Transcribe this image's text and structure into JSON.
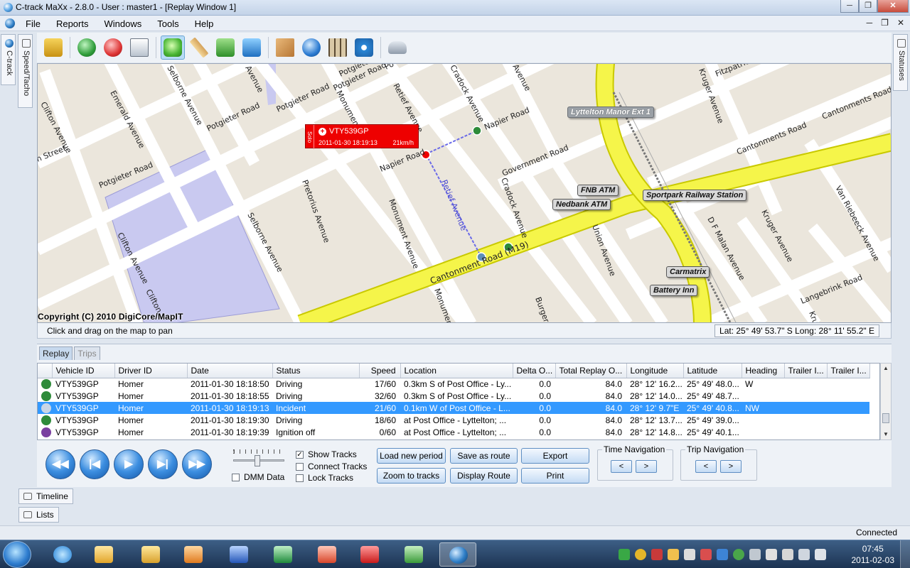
{
  "window": {
    "title": "C-track MaXx - 2.8.0 - User : master1 - [Replay Window 1]",
    "min": "─",
    "max": "❐",
    "close": "✕"
  },
  "menu": {
    "items": [
      "File",
      "Reports",
      "Windows",
      "Tools",
      "Help"
    ],
    "mdi": [
      "─",
      "❐",
      "✕"
    ]
  },
  "side_tabs": {
    "left": [
      "C-track",
      "Speed/Tacho"
    ],
    "right": [
      "Statuses"
    ]
  },
  "toolbar": {
    "buttons": [
      "vehicle-locate",
      "zoom-in",
      "zoom-out",
      "window-select",
      "pan",
      "measure",
      "refresh",
      "download",
      "map-layers",
      "info",
      "grid",
      "settings",
      "vehicle"
    ]
  },
  "map": {
    "copyright": "Copyright (C) 2010 DigiCore/MapIT",
    "streets": [
      "Clifton Avenue",
      "Emerald Avenue",
      "Selborne Avenue",
      "Potgieter Road",
      "Potgieter Road",
      "Potgieter Road",
      "Potgieter Road",
      "Po",
      "Avenue",
      "Monument",
      "Retief Avenue",
      "Cradock Avenue",
      "Avenue",
      "Napier Road",
      "Napier Road",
      "Government Road",
      "Fitzpatrick",
      "Kruger Avenue",
      "Cantonments Road",
      "Cantonments Road",
      "h Street",
      "Potgieter Road",
      "Pretorius Avenue",
      "Selborne Avenue",
      "Monument Avenue",
      "Cradock Avenue",
      "Union Avenue",
      "D F Malan Avenue",
      "Kruger Avenue",
      "Van Riebeeck Avenue",
      "Clifton Avenue",
      "Clifton",
      "Cantonment Road (M19)",
      "Monument",
      "Burger",
      "Langebrink Road",
      "Kru",
      "Retief Avenue"
    ],
    "pois": [
      "Lyttelton Manor Ext 1",
      "FNB ATM",
      "Nedbank ATM",
      "Sportpark Railway Station",
      "Carmatrix",
      "Battery Inn"
    ],
    "callout": {
      "side": "Solo",
      "vehicle": "VTY539GP",
      "datetime": "2011-01-30 18:19:13",
      "speed": "21km/h"
    },
    "hint": "Click and drag on the map to pan",
    "coords": "Lat: 25° 49' 53.7\" S  Long: 28° 11' 55.2\" E"
  },
  "panel": {
    "tabs": [
      "Replay",
      "Trips"
    ],
    "columns": [
      "Vehicle ID",
      "Driver ID",
      "Date",
      "Status",
      "Speed",
      "Location",
      "Delta O...",
      "Total Replay O...",
      "Longitude",
      "Latitude",
      "Heading",
      "Trailer I...",
      "Trailer I..."
    ],
    "rows": [
      {
        "vehicle": "VTY539GP",
        "driver": "Homer",
        "date": "2011-01-30 18:18:50",
        "status": "Driving",
        "speed": "17/60",
        "location": "0.3km S of Post Office - Ly...",
        "delta": "0.0",
        "total": "84.0",
        "lon": "28° 12' 16.2...",
        "lat": "25° 49' 48.0...",
        "heading": "W",
        "icon": "#2e8b3a"
      },
      {
        "vehicle": "VTY539GP",
        "driver": "Homer",
        "date": "2011-01-30 18:18:55",
        "status": "Driving",
        "speed": "32/60",
        "location": "0.3km S of Post Office - Ly...",
        "delta": "0.0",
        "total": "84.0",
        "lon": "28° 12' 14.0...",
        "lat": "25° 49' 48.7...",
        "heading": "",
        "icon": "#2e8b3a"
      },
      {
        "vehicle": "VTY539GP",
        "driver": "Homer",
        "date": "2011-01-30 18:19:13",
        "status": "Incident",
        "speed": "21/60",
        "location": "0.1km W of Post Office - L...",
        "delta": "0.0",
        "total": "84.0",
        "lon": "28° 12' 9.7\"E",
        "lat": "25° 49' 40.8...",
        "heading": "NW",
        "icon": "#c9d6e6",
        "selected": true
      },
      {
        "vehicle": "VTY539GP",
        "driver": "Homer",
        "date": "2011-01-30 18:19:30",
        "status": "Driving",
        "speed": "18/60",
        "location": "at Post Office - Lyttelton; ...",
        "delta": "0.0",
        "total": "84.0",
        "lon": "28° 12' 13.7...",
        "lat": "25° 49' 39.0...",
        "heading": "",
        "icon": "#2e8b3a"
      },
      {
        "vehicle": "VTY539GP",
        "driver": "Homer",
        "date": "2011-01-30 18:19:39",
        "status": "Ignition off",
        "speed": "0/60",
        "location": "at Post Office - Lyttelton; ...",
        "delta": "0.0",
        "total": "84.0",
        "lon": "28° 12' 14.8...",
        "lat": "25° 49' 40.1...",
        "heading": "",
        "icon": "#7a3fa0"
      }
    ],
    "nav": [
      "◀◀",
      "|◀",
      "▶",
      "▶|",
      "▶▶"
    ],
    "checks": [
      {
        "label": "Show Tracks",
        "checked": true
      },
      {
        "label": "Connect Tracks",
        "checked": false
      },
      {
        "label": "Lock Tracks",
        "checked": false
      },
      {
        "label": "DMM Data",
        "checked": false
      }
    ],
    "buttons": [
      "Load new period",
      "Save as route",
      "Export",
      "Zoom to tracks",
      "Display Route",
      "Print"
    ],
    "time_nav": {
      "label": "Time Navigation",
      "prev": "<",
      "next": ">"
    },
    "trip_nav": {
      "label": "Trip Navigation",
      "prev": "<",
      "next": ">"
    }
  },
  "lower_tabs": [
    "Timeline",
    "Lists"
  ],
  "status": "Connected",
  "taskbar": {
    "time": "07:45",
    "date": "2011-02-03"
  }
}
